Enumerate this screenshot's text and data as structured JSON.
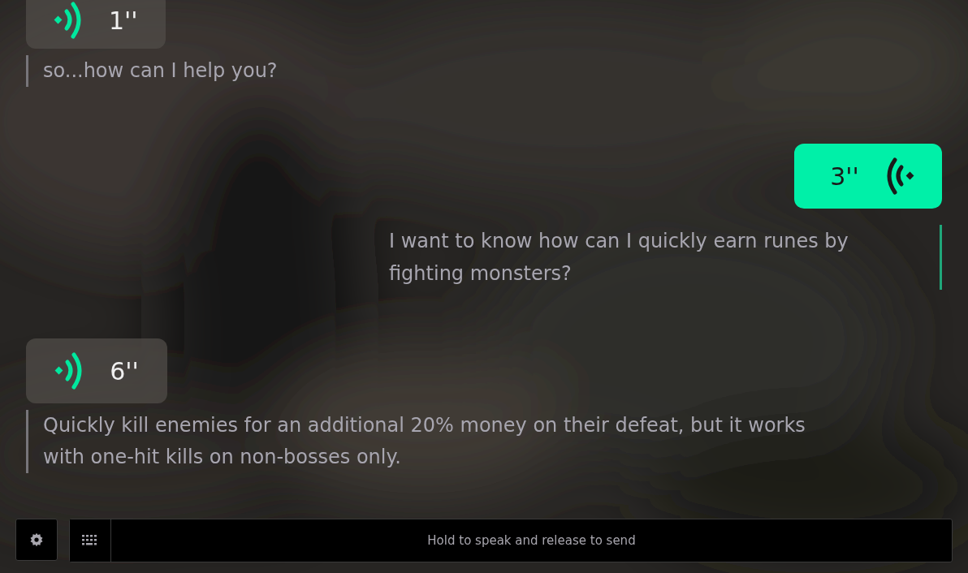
{
  "messages": [
    {
      "kind": "incoming",
      "duration": "1''",
      "text": "so...how can I help you?"
    },
    {
      "kind": "outgoing",
      "duration": "3''",
      "text": "I want to know how can I quickly earn runes by fighting monsters?"
    },
    {
      "kind": "incoming",
      "duration": "6''",
      "text": "Quickly kill enemies for an additional 20% money on their defeat, but it works with one-hit kills on non-bosses only."
    }
  ],
  "input": {
    "placeholder": "Hold to speak and release to send"
  }
}
